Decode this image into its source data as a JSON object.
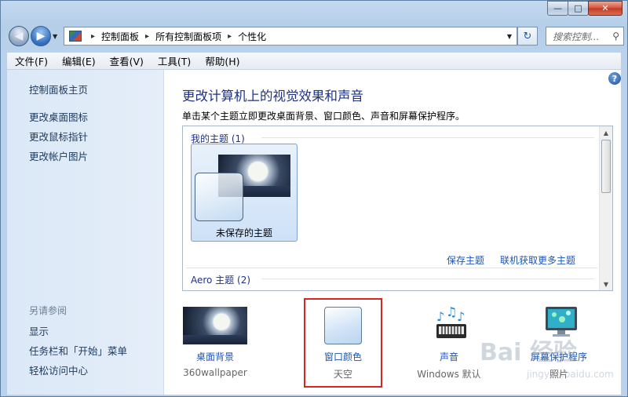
{
  "window": {
    "caption_buttons": [
      "—",
      "□",
      "✕"
    ]
  },
  "nav": {
    "back_icon": "back-arrow-icon",
    "forward_icon": "forward-arrow-icon",
    "breadcrumbs": [
      "控制面板",
      "所有控制面板项",
      "个性化"
    ],
    "refresh_icon": "refresh-icon",
    "search_placeholder": "搜索控制...",
    "search_icon": "search-icon"
  },
  "menu": {
    "items": [
      "文件(F)",
      "编辑(E)",
      "查看(V)",
      "工具(T)",
      "帮助(H)"
    ]
  },
  "sidebar": {
    "links": [
      "控制面板主页",
      "更改桌面图标",
      "更改鼠标指针",
      "更改帐户图片"
    ],
    "see_also_title": "另请参阅",
    "see_also": [
      "显示",
      "任务栏和「开始」菜单",
      "轻松访问中心"
    ]
  },
  "main": {
    "title": "更改计算机上的视觉效果和声音",
    "description": "单击某个主题立即更改桌面背景、窗口颜色、声音和屏幕保护程序。",
    "my_themes_header": "我的主题 (1)",
    "unsaved_theme_label": "未保存的主题",
    "save_theme_link": "保存主题",
    "more_themes_link": "联机获取更多主题",
    "aero_header": "Aero 主题 (2)"
  },
  "bottom": {
    "items": [
      {
        "label": "桌面背景",
        "value": "360wallpaper",
        "icon": "wallpaper-icon"
      },
      {
        "label": "窗口颜色",
        "value": "天空",
        "icon": "window-color-icon"
      },
      {
        "label": "声音",
        "value": "Windows 默认",
        "icon": "sound-icon"
      },
      {
        "label": "屏幕保护程序",
        "value": "照片",
        "icon": "screensaver-icon"
      }
    ]
  },
  "watermark": {
    "brand": "Bai 经验",
    "url": "jingyan.baidu.com"
  },
  "colors": {
    "title_blue": "#1e3287",
    "link_blue": "#1e55b3",
    "highlight_red": "#d7271c"
  }
}
